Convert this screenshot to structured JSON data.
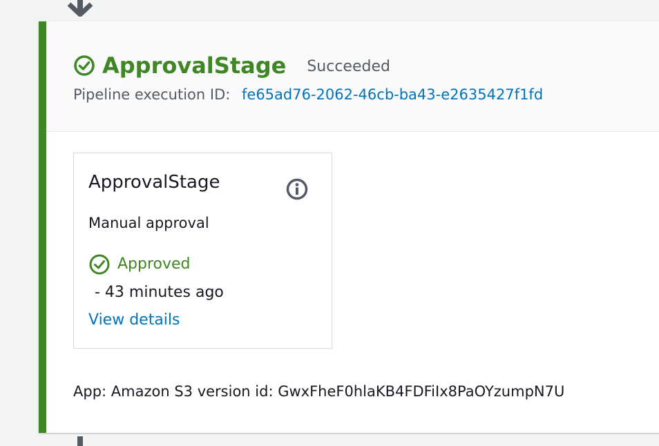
{
  "stage": {
    "title": "ApprovalStage",
    "status": "Succeeded",
    "execution_label": "Pipeline execution ID:",
    "execution_id": "fe65ad76-2062-46cb-ba43-e2635427f1fd"
  },
  "action": {
    "title": "ApprovalStage",
    "provider": "Manual approval",
    "status": "Approved",
    "time": "-  43 minutes ago",
    "details_link": "View details"
  },
  "artifact": {
    "text": "App: Amazon S3 version id: GwxFheF0hlaKB4FDFiIx8PaOYzumpN7U"
  },
  "icons": {
    "stage_status": "check-circle-icon",
    "action_info": "info-icon",
    "action_status": "check-circle-icon",
    "flow_in": "arrow-down-icon",
    "flow_out": "connector-line-icon"
  },
  "colors": {
    "success": "#3f8624",
    "link": "#0073bb",
    "muted": "#545b64",
    "text": "#16191f",
    "background": "#f2f3f3"
  }
}
